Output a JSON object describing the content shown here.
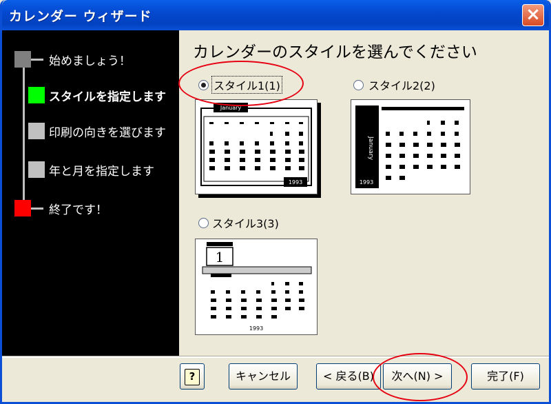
{
  "window": {
    "title": "カレンダー ウィザード",
    "close_label": "×"
  },
  "steps": [
    {
      "label": "始めましょう！",
      "color": "#808080",
      "current": false
    },
    {
      "label": "スタイルを指定します",
      "color": "#00ff00",
      "current": true
    },
    {
      "label": "印刷の向きを選びます",
      "color": "#c0c0c0",
      "current": false
    },
    {
      "label": "年と月を指定します",
      "color": "#c0c0c0",
      "current": false
    },
    {
      "label": "終了です！",
      "color": "#ff0000",
      "current": false
    }
  ],
  "heading": "カレンダーのスタイルを選んでください",
  "options": [
    {
      "label": "スタイル1(1)",
      "checked": true
    },
    {
      "label": "スタイル2(2)",
      "checked": false
    },
    {
      "label": "スタイル3(3)",
      "checked": false
    }
  ],
  "previews": {
    "style1": {
      "month": "January",
      "year": "1993"
    },
    "style2": {
      "month": "January",
      "year": "1993"
    },
    "style3": {
      "day": "1",
      "year": "1993"
    }
  },
  "buttons": {
    "help": "?",
    "cancel": "キャンセル",
    "back": "< 戻る(B)",
    "next": "次へ(N) >",
    "finish": "完了(F)"
  },
  "annotation_color": "#e60012"
}
